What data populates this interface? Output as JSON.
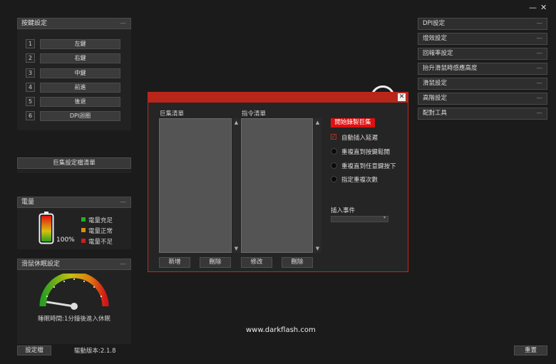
{
  "window_controls": {
    "minimize": "—",
    "close": "✕"
  },
  "key_settings": {
    "title": "按鍵設定",
    "buttons": [
      {
        "num": "1",
        "label": "左鍵"
      },
      {
        "num": "2",
        "label": "右鍵"
      },
      {
        "num": "3",
        "label": "中鍵"
      },
      {
        "num": "4",
        "label": "前進"
      },
      {
        "num": "5",
        "label": "後退"
      },
      {
        "num": "6",
        "label": "DPI迴圈"
      }
    ]
  },
  "macro_list_button": "巨集設定檔清單",
  "battery": {
    "title": "電量",
    "percent": "100%",
    "level": 1.0,
    "legend": [
      {
        "label": "電量充足",
        "color": "#22b022"
      },
      {
        "label": "電量正常",
        "color": "#e08a10"
      },
      {
        "label": "電量不足",
        "color": "#d01c1c"
      }
    ]
  },
  "sleep": {
    "title": "滑鼠休眠設定",
    "text": "睡眠時間:1分鐘後進入休眠",
    "value_fraction": 0.05
  },
  "footer": {
    "profile_button": "設定檔",
    "driver_version": "驅動版本:2.1.8",
    "website": "www.darkflash.com",
    "reset_button": "重置"
  },
  "right_menu": [
    "DPI設定",
    "燈效設定",
    "回報率設定",
    "抬升滑鼠時感應高度",
    "滑鼠設定",
    "高階設定",
    "配對工具"
  ],
  "macro_dialog": {
    "close": "✕",
    "macro_list_label": "巨集清單",
    "command_list_label": "指令清單",
    "record_button": "開始錄製巨集",
    "auto_delay": "自動插入延遲",
    "auto_delay_checked": true,
    "options": [
      "重複直到按鍵鬆開",
      "重複直到任意鍵按下",
      "指定重複次數"
    ],
    "insert_event_label": "插入事件",
    "buttons": {
      "add": "新增",
      "delete1": "刪除",
      "modify": "修改",
      "delete2": "刪除"
    },
    "accent": "#c0281c"
  }
}
